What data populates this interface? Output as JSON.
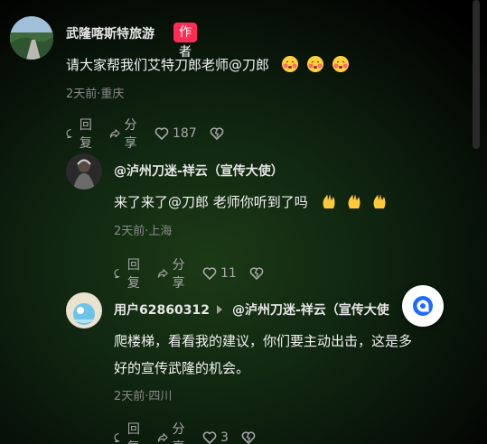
{
  "comments": [
    {
      "user": "武隆喀斯特旅游",
      "badge": "作者",
      "text": "请大家帮我们艾特刀郎老师@刀郎",
      "meta": "2天前·重庆",
      "reply_label": "回复",
      "share_label": "分享",
      "likes": "187"
    },
    {
      "user": "@泸州刀迷-祥云（宣传大使）",
      "text": "来了来了@刀郎 老师你听到了吗",
      "meta": "2天前·上海",
      "reply_label": "回复",
      "share_label": "分享",
      "likes": "11"
    },
    {
      "user": "用户62860312",
      "reply_to": "@泸州刀迷-祥云（宣传大使",
      "text_line1": "爬楼梯，看看我的建议，你们要主动出击，这是多",
      "text_line2": "好的宣传武隆的机会。",
      "meta": "2天前·四川",
      "reply_label": "回复",
      "share_label": "分享",
      "likes": "3"
    }
  ],
  "colors": {
    "badge": "#fe2c55",
    "float_button_icon": "#1e6bff"
  }
}
